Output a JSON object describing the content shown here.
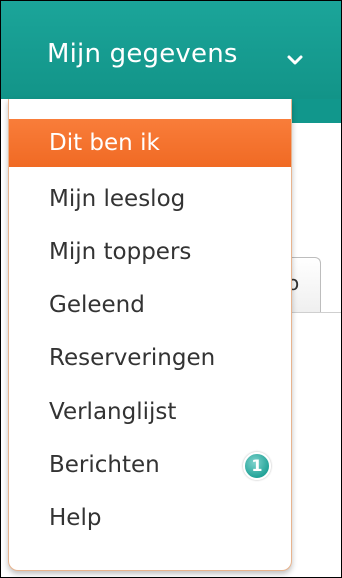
{
  "nav": {
    "title": "Mijn gegevens",
    "chevron_icon": "chevron-down-icon",
    "background_color": "#17a094"
  },
  "background_page": {
    "tab_fragment": "o"
  },
  "menu": {
    "accent_color": "#f47330",
    "items": [
      {
        "label": "Dit ben ik",
        "active": true
      },
      {
        "label": "Mijn leeslog"
      },
      {
        "label": "Mijn toppers"
      },
      {
        "label": "Geleend"
      },
      {
        "label": "Reserveringen"
      },
      {
        "label": "Verlanglijst"
      },
      {
        "label": "Berichten",
        "badge": "1"
      },
      {
        "label": "Help"
      }
    ]
  }
}
